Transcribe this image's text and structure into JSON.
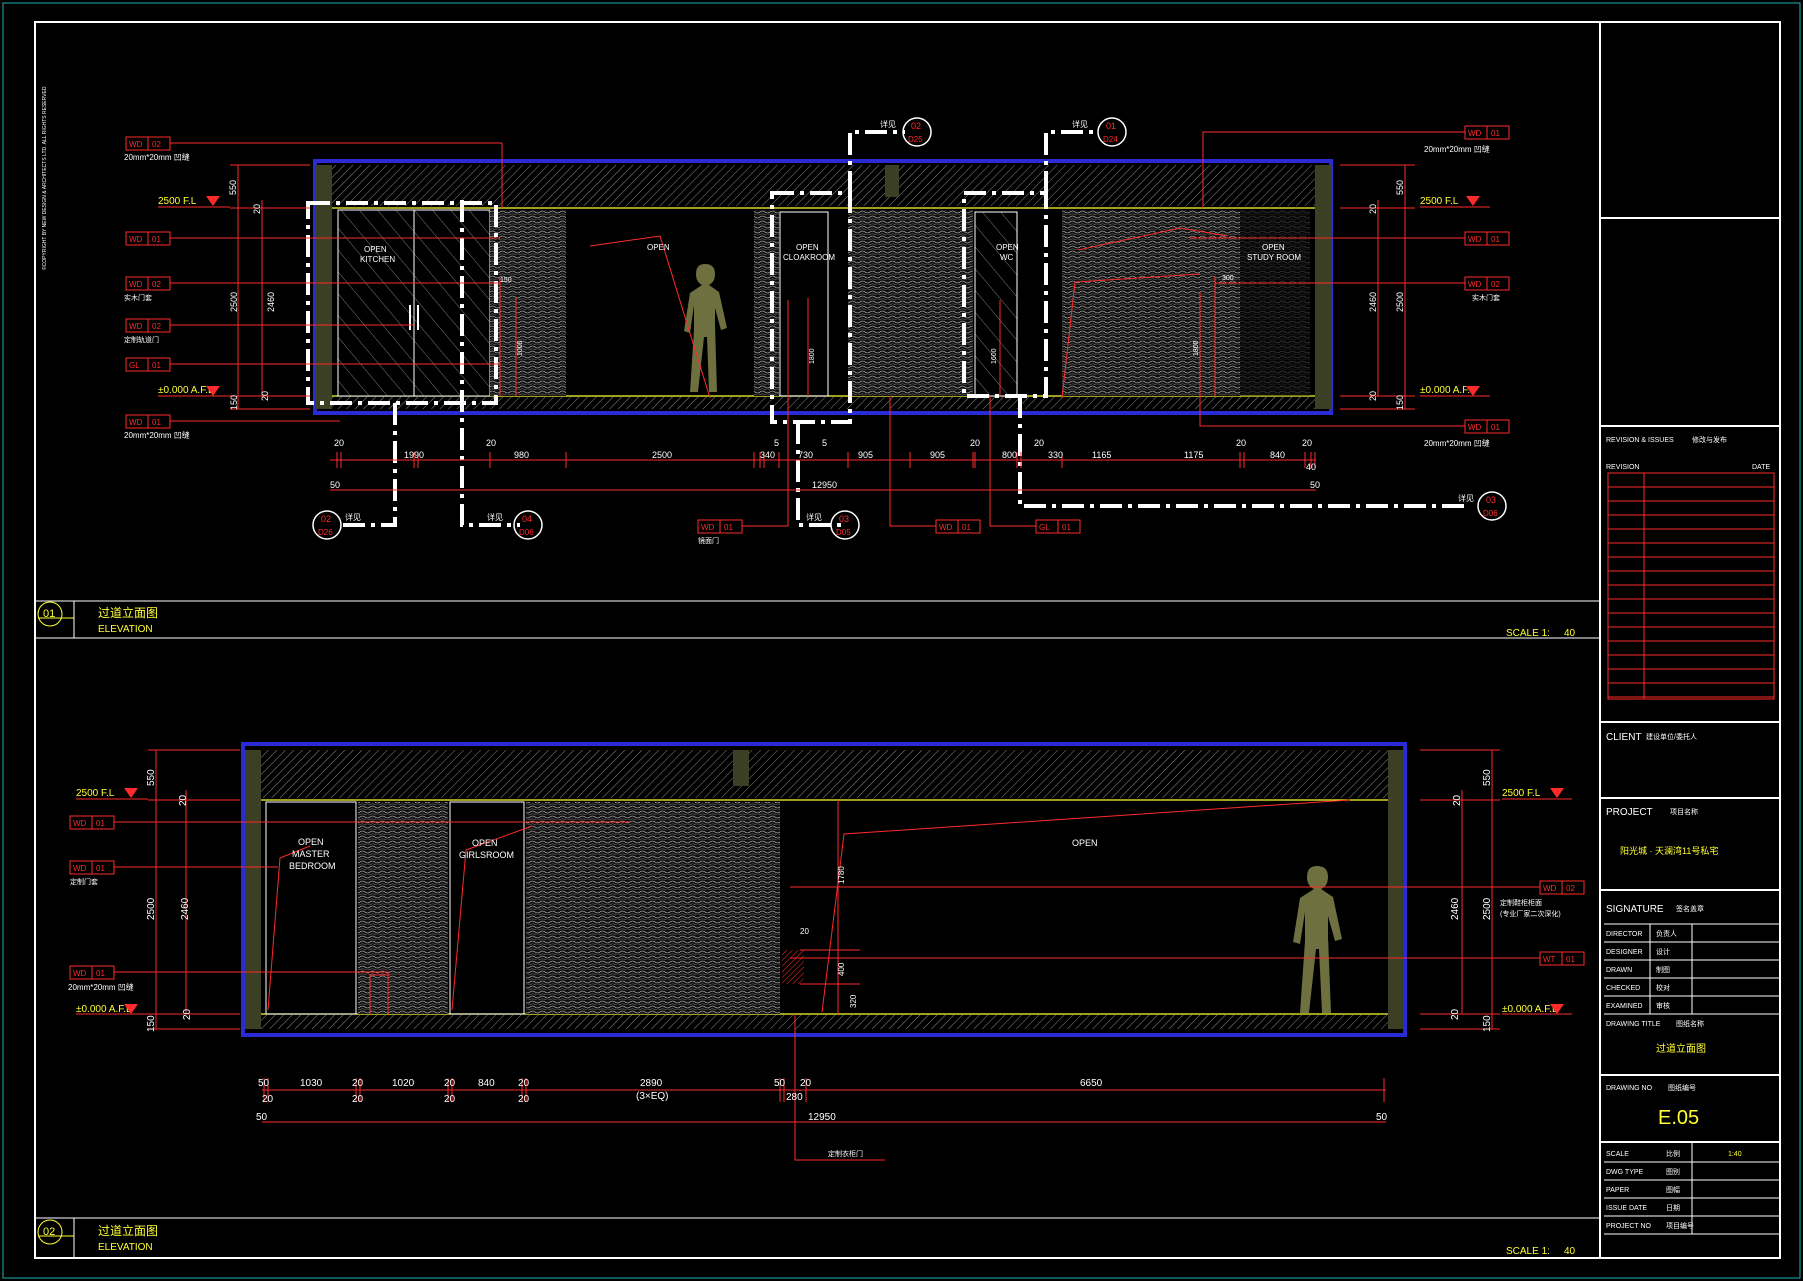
{
  "copyright": "©COPYRIGHT BY NEW DESIGN & ARCHITECTS LTD. ALL RIGHTS RESERVED",
  "colors": {
    "frame": "#ffffff",
    "dim": "#ff2a2a",
    "accent": "#ffff33",
    "wall": "#3b3f23",
    "blue": "#2b2bd6"
  },
  "tags": {
    "wd": "WD",
    "wt": "WT",
    "gl": "GL",
    "n01": "01",
    "n02": "02",
    "ceiling_550": "20mm*20mm 凹缝",
    "skirting": "20mm*20mm 凹缝",
    "door_cover": "实木门套",
    "custom_door": "定制轨道门",
    "mirror_door": "镜面门",
    "custom_door2": "定制门套",
    "callout_fig": "详见",
    "c01": "01",
    "c02": "02",
    "c03": "03",
    "c04": "04",
    "s_d26": "D26",
    "s_d25": "D25",
    "s_d24": "D24",
    "s_d05": "D05",
    "s_d06": "D06"
  },
  "elev1": {
    "level_top": "2500 F.L",
    "level_bottom": "±0.000 A.F.L",
    "rooms": [
      "OPEN",
      "KITCHEN",
      "OPEN",
      "OPEN",
      "CLOAKROOM",
      "OPEN",
      "WC",
      "OPEN",
      "STUDY ROOM"
    ],
    "dims": [
      "20",
      "1990",
      "20",
      "980",
      "2500",
      "340",
      "5",
      "730",
      "5",
      "905",
      "905",
      "20",
      "800",
      "20",
      "330",
      "1165",
      "1175",
      "20",
      "840",
      "20",
      "40"
    ],
    "total": "12950",
    "ends": [
      "50",
      "50"
    ],
    "vert_left": [
      "550",
      "20",
      "2460",
      "2500",
      "20",
      "150"
    ],
    "vert_right": [
      "550",
      "20",
      "2460",
      "2500",
      "20",
      "150"
    ],
    "inner": [
      "150",
      "1000",
      "1800",
      "1600",
      "300",
      "1800"
    ]
  },
  "elev2": {
    "level_top": "2500 F.L",
    "level_bottom": "±0.000 A.F.L",
    "rooms": [
      "OPEN",
      "MASTER",
      "BEDROOM",
      "OPEN",
      "GIRLSROOM",
      "OPEN"
    ],
    "dims": [
      "50",
      "1030",
      "20",
      "1020",
      "20",
      "840",
      "20",
      "2890",
      "(3×EQ)",
      "50",
      "20",
      "280",
      "6650"
    ],
    "subdims": [
      "20",
      "20",
      "20",
      "20"
    ],
    "total": "12950",
    "ends": [
      "50",
      "50"
    ],
    "vert_left": [
      "550",
      "20",
      "2460",
      "2500",
      "20",
      "150"
    ],
    "vert_right": [
      "550",
      "20",
      "2460",
      "2500",
      "20",
      "150"
    ],
    "inner": [
      "1780",
      "20",
      "400",
      "320"
    ],
    "notes": [
      "定制衣柜门",
      "(专业厂家二次深化)",
      "定制鞋柜柜面"
    ]
  },
  "titles": [
    {
      "num": "01",
      "cn": "过道立面图",
      "en": "ELEVATION",
      "scale_label": "SCALE 1:",
      "scale_val": "40"
    },
    {
      "num": "02",
      "cn": "过道立面图",
      "en": "ELEVATION",
      "scale_label": "SCALE 1:",
      "scale_val": "40"
    }
  ],
  "titleblock": {
    "revision_issues": "REVISION & ISSUES",
    "revision_issues_cn": "修改与发布",
    "revision": "REVISION",
    "date": "DATE",
    "client": "CLIENT",
    "client_cn": "建设单位/委托人",
    "project": "PROJECT",
    "project_cn": "项目名称",
    "project_name": "阳光城 · 天澜湾11号私宅",
    "signature": "SIGNATURE",
    "signature_cn": "签名盖章",
    "sig_rows": [
      {
        "en": "DIRECTOR",
        "cn": "负责人"
      },
      {
        "en": "DESIGNER",
        "cn": "设计"
      },
      {
        "en": "DRAWN",
        "cn": "制图"
      },
      {
        "en": "CHECKED",
        "cn": "校对"
      },
      {
        "en": "EXAMINED",
        "cn": "审核"
      }
    ],
    "drawing_title": "DRAWING TITLE",
    "drawing_title_cn": "图纸名称",
    "drawing_name": "过道立面图",
    "drawing_no": "DRAWING NO",
    "drawing_no_cn": "图纸编号",
    "drawing_no_val": "E.05",
    "info_rows": [
      {
        "en": "SCALE",
        "cn": "比例",
        "val": "1:40"
      },
      {
        "en": "DWG TYPE",
        "cn": "图别",
        "val": ""
      },
      {
        "en": "PAPER",
        "cn": "图幅",
        "val": ""
      },
      {
        "en": "ISSUE DATE",
        "cn": "日期",
        "val": ""
      },
      {
        "en": "PROJECT NO",
        "cn": "项目编号",
        "val": ""
      }
    ]
  }
}
